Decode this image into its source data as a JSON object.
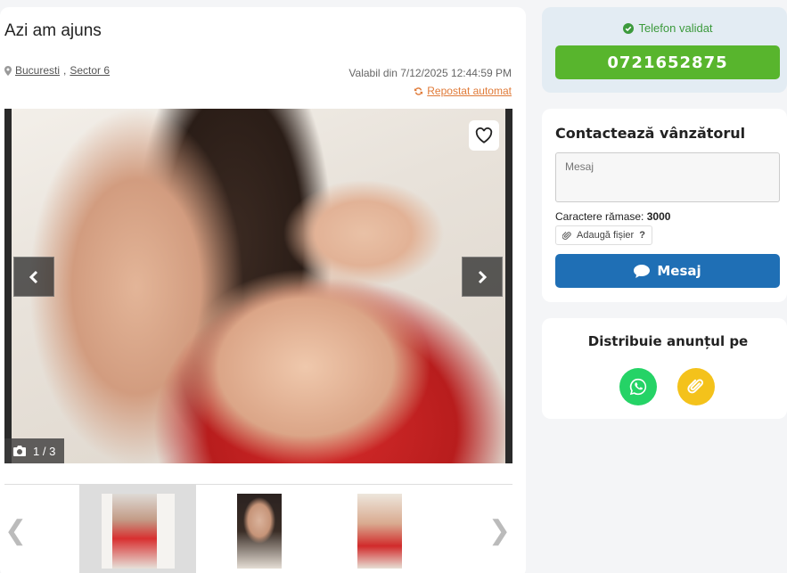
{
  "listing": {
    "title": "Azi am ajuns",
    "location_city": "Bucuresti",
    "location_sector": "Sector 6",
    "valid_from": "Valabil din 7/12/2025 12:44:59 PM",
    "repost_label": "Repostat automat"
  },
  "gallery": {
    "counter": "1 / 3",
    "prev_glyph": "❮",
    "next_glyph": "❯"
  },
  "phone": {
    "validated_label": "Telefon validat",
    "number": "0721652875"
  },
  "contact": {
    "title": "Contactează vânzătorul",
    "message_placeholder": "Mesaj",
    "chars_label": "Caractere rămase:",
    "chars_count": "3000",
    "attach_label": "Adaugă fișier",
    "attach_help": "?",
    "send_label": "Mesaj"
  },
  "share": {
    "title": "Distribuie anunțul pe"
  },
  "colors": {
    "phone_green": "#58b52d",
    "send_blue": "#1f6fb5",
    "whatsapp_green": "#25d366",
    "copy_yellow": "#f4c21b",
    "repost_orange": "#e07b39"
  }
}
